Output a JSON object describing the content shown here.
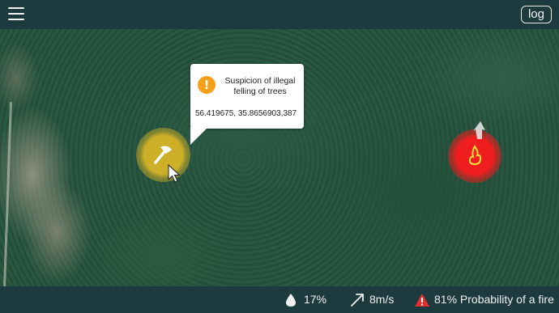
{
  "header": {
    "menu_icon": "hamburger-menu-icon",
    "log_label": "log"
  },
  "alert": {
    "icon": "warning-icon",
    "title": "Suspicion of illegal felling of trees",
    "coordinates": "56.419675, 35.8656903,387"
  },
  "markers": {
    "felling": {
      "icon": "axe-icon",
      "color": "#cdaf28"
    },
    "fire": {
      "icon": "flame-icon",
      "color": "#f01e1e"
    }
  },
  "status": {
    "humidity": {
      "icon": "water-drop-icon",
      "value": "17%"
    },
    "wind": {
      "icon": "wind-arrow-icon",
      "value": "8m/s"
    },
    "fire_probability": {
      "icon": "warning-triangle-icon",
      "text": "81% Probability of a fire",
      "color": "#e53030"
    }
  }
}
